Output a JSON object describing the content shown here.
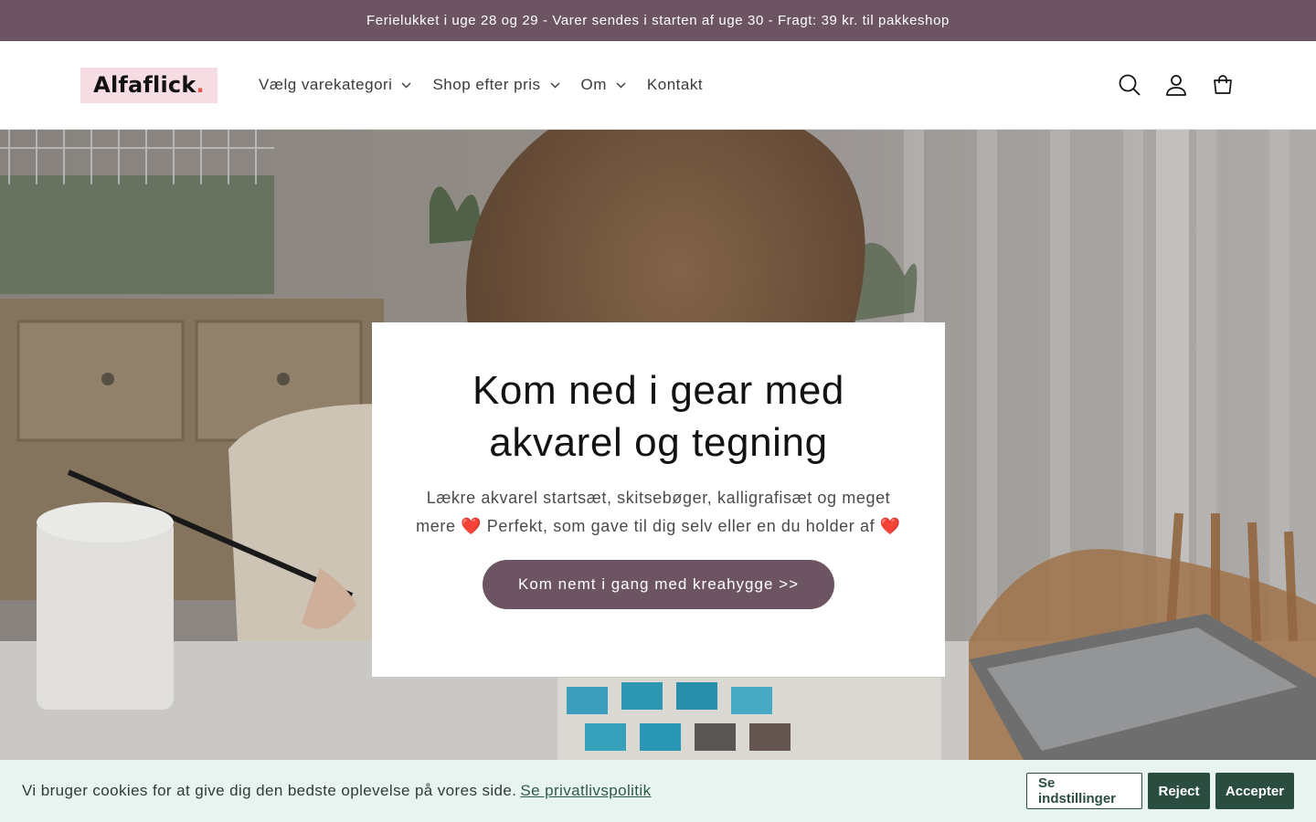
{
  "announcement": {
    "text": "Ferielukket i uge 28 og 29 - Varer sendes i starten af uge 30 - Fragt: 39 kr. til pakkeshop"
  },
  "header": {
    "logo_text": "Alfaflick",
    "logo_dot": ".",
    "nav": [
      {
        "label": "Vælg varekategori",
        "has_dropdown": true
      },
      {
        "label": "Shop efter pris",
        "has_dropdown": true
      },
      {
        "label": "Om",
        "has_dropdown": true
      },
      {
        "label": "Kontakt",
        "has_dropdown": false
      }
    ],
    "icons": [
      "search-icon",
      "account-icon",
      "cart-icon"
    ]
  },
  "hero": {
    "title": "Kom ned i gear med akvarel og tegning",
    "subtitle": "Lækre akvarel startsæt, skitsebøger, kalligrafisæt og meget mere ❤️ Perfekt, som gave til dig selv eller en du holder af ❤️",
    "button_label": "Kom nemt i gang med kreahygge >>"
  },
  "cookie": {
    "text": "Vi bruger cookies for at give dig den bedste oplevelse på vores side.",
    "link": "Se privatlivspolitik",
    "settings_label": "Se indstillinger",
    "reject_label": "Reject",
    "accept_label": "Accepter"
  },
  "colors": {
    "brand": "#6d5462",
    "cookie_bg": "#e8f4ef",
    "cookie_button": "#2b4d40",
    "logo_bg": "#f6dde3",
    "logo_dot": "#e8594a"
  }
}
